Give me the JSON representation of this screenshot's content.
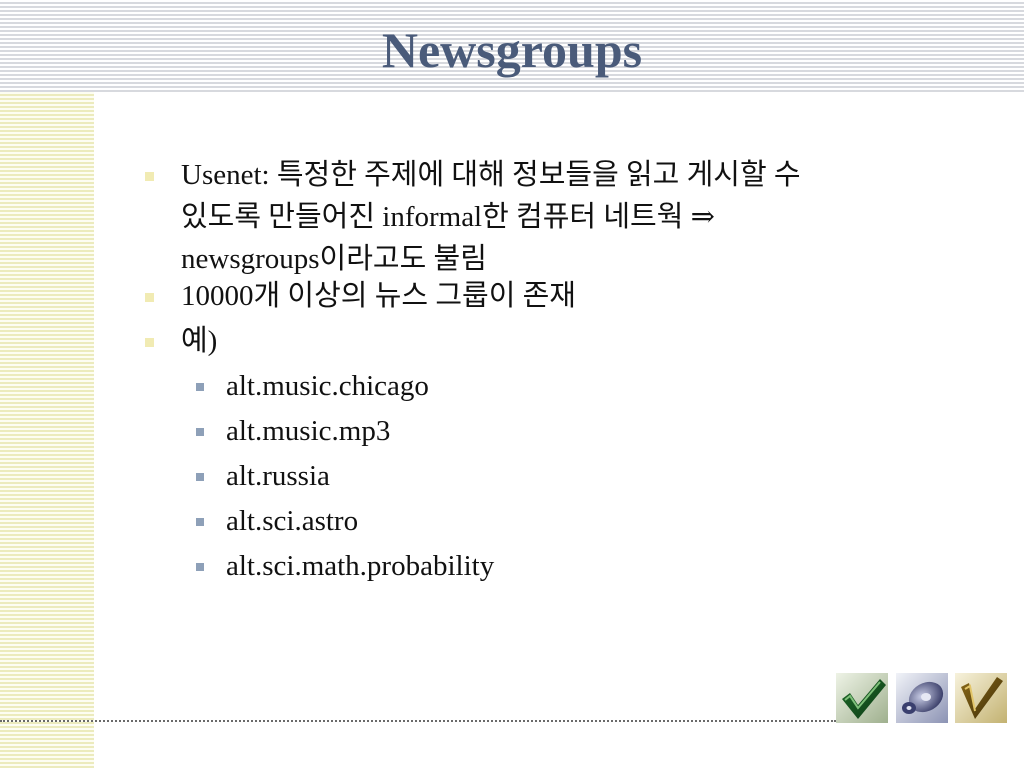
{
  "slide": {
    "title": "Newsgroups",
    "bullets": [
      {
        "level": 1,
        "lines": [
          "Usenet: 특정한 주제에 대해 정보들을 읽고 게시할 수",
          "있도록 만들어진 informal한 컴퓨터 네트웍 ⇒",
          "newsgroups이라고도 불림"
        ]
      },
      {
        "level": 1,
        "lines": [
          "10000개 이상의 뉴스 그룹이 존재"
        ]
      },
      {
        "level": 1,
        "lines": [
          "예)"
        ]
      },
      {
        "level": 2,
        "lines": [
          "alt.music.chicago"
        ]
      },
      {
        "level": 2,
        "lines": [
          "alt.music.mp3"
        ]
      },
      {
        "level": 2,
        "lines": [
          "alt.russia"
        ]
      },
      {
        "level": 2,
        "lines": [
          "alt.sci.astro"
        ]
      },
      {
        "level": 2,
        "lines": [
          "alt.sci.math.probability"
        ]
      }
    ]
  },
  "decor": {
    "title_color": "#4a5b7a",
    "level1_bullet_color": "#f1ebb3",
    "level2_bullet_color": "#8ea0b8",
    "icons": [
      "green-checkmark-icon",
      "blue-disc-icon",
      "gold-checkmark-icon"
    ]
  }
}
